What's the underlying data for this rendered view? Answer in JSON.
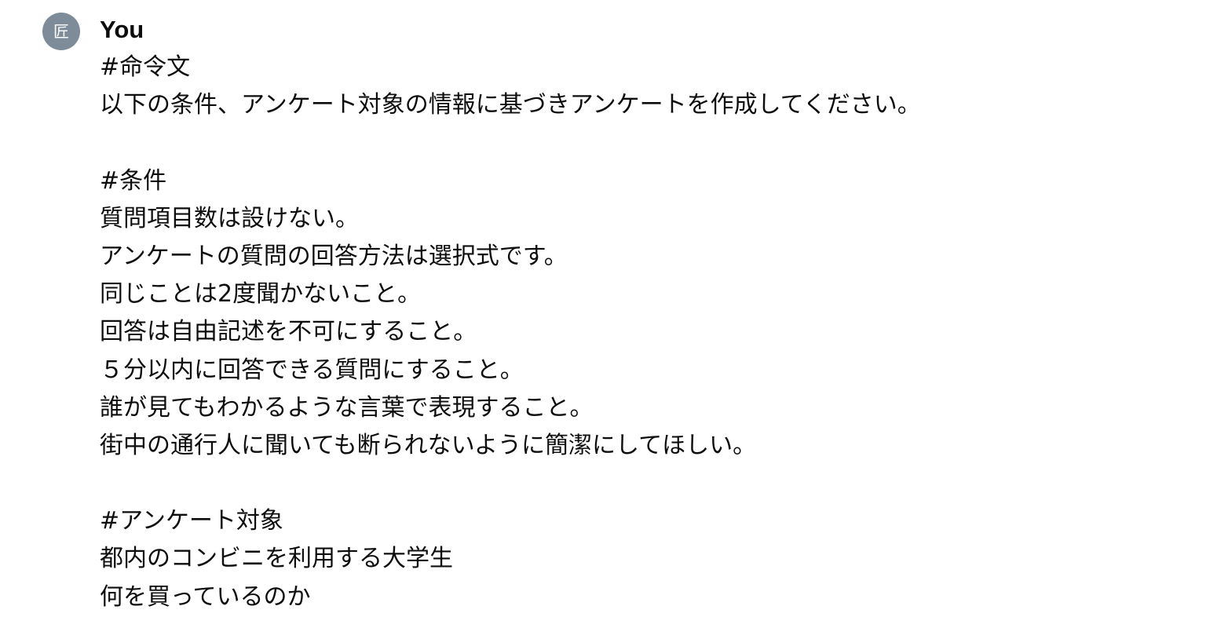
{
  "message": {
    "author": "You",
    "avatar_text": "匠",
    "avatar_color": "#7e8b98",
    "lines": [
      "#命令文",
      "以下の条件、アンケート対象の情報に基づきアンケートを作成してください。",
      "",
      "#条件",
      "質問項目数は設けない。",
      "アンケートの質問の回答方法は選択式です。",
      "同じことは2度聞かないこと。",
      "回答は自由記述を不可にすること。",
      "５分以内に回答できる質問にすること。",
      "誰が見てもわかるような言葉で表現すること。",
      "街中の通行人に聞いても断られないように簡潔にしてほしい。",
      "",
      "#アンケート対象",
      "都内のコンビニを利用する大学生",
      "何を買っているのか"
    ]
  }
}
